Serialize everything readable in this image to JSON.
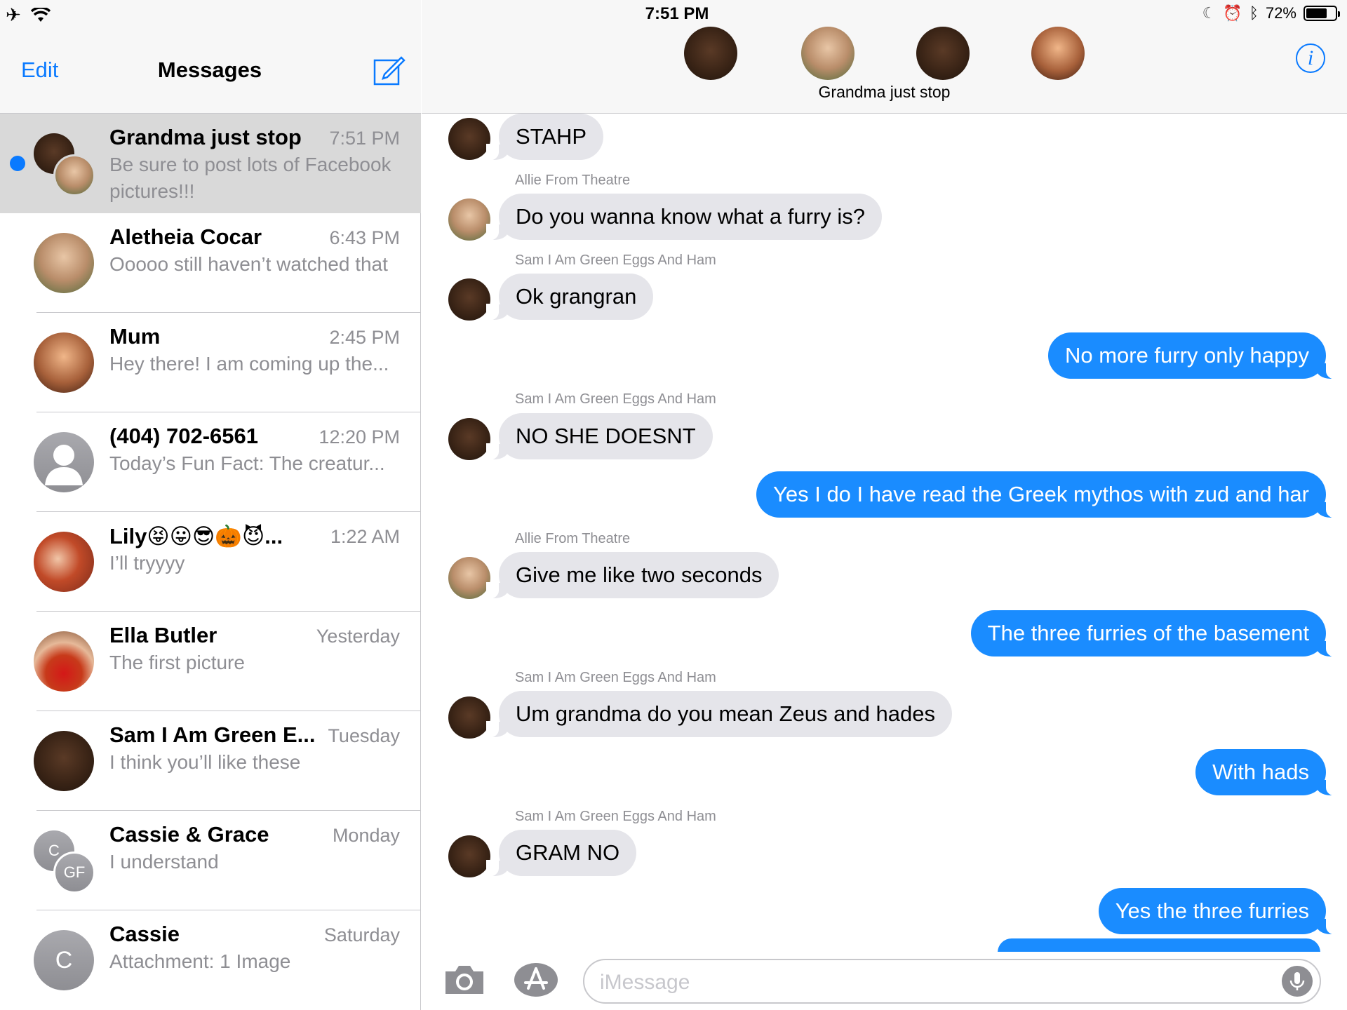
{
  "status_bar": {
    "time": "7:51 PM",
    "battery": "72%",
    "battery_level": 0.72,
    "icons": [
      "airplane-icon",
      "wifi-icon",
      "moon-icon",
      "alarm-icon",
      "bluetooth-icon",
      "battery-icon"
    ]
  },
  "sidebar": {
    "edit_label": "Edit",
    "title": "Messages",
    "compose_icon": "compose-icon",
    "conversations": [
      {
        "name": "Grandma just stop",
        "time": "7:51 PM",
        "preview": "Be sure to post lots of Facebook pictures!!!",
        "unread": true,
        "selected": true
      },
      {
        "name": "Aletheia Cocar",
        "time": "6:43 PM",
        "preview": "Ooooo still haven’t watched that"
      },
      {
        "name": "Mum",
        "time": "2:45 PM",
        "preview": "Hey there! I am coming up the..."
      },
      {
        "name": "(404) 702-6561",
        "time": "12:20 PM",
        "preview": "Today’s Fun Fact: The creatur..."
      },
      {
        "name": "Lily😝😛😎🎃😈...",
        "time": "1:22 AM",
        "preview": "I’ll tryyyy"
      },
      {
        "name": "Ella Butler",
        "time": "Yesterday",
        "preview": "The first picture"
      },
      {
        "name": "Sam I Am Green E...",
        "time": "Tuesday",
        "preview": "I think you’ll like these"
      },
      {
        "name": "Cassie & Grace",
        "time": "Monday",
        "preview": "I understand",
        "initials": [
          "C",
          "GF"
        ]
      },
      {
        "name": "Cassie",
        "time": "Saturday",
        "preview": "Attachment: 1 Image",
        "initials": [
          "C"
        ]
      }
    ]
  },
  "chat": {
    "group_name": "Grandma just stop",
    "info_icon": "info-icon",
    "messages": [
      {
        "dir": "in",
        "sender": "",
        "text": "STAHP"
      },
      {
        "dir": "in",
        "sender": "Allie From Theatre",
        "text": "Do you wanna know what a furry is?"
      },
      {
        "dir": "in",
        "sender": "Sam I Am Green Eggs And Ham",
        "text": "Ok grangran"
      },
      {
        "dir": "out",
        "sender": "",
        "text": "No more furry only happy"
      },
      {
        "dir": "in",
        "sender": "Sam I Am Green Eggs And Ham",
        "text": "NO SHE DOESNT"
      },
      {
        "dir": "out",
        "sender": "",
        "text": "Yes I do I have read the Greek mythos with zud and har"
      },
      {
        "dir": "in",
        "sender": "Allie From Theatre",
        "text": "Give me like two seconds"
      },
      {
        "dir": "out",
        "sender": "",
        "text": "The three furries of the basement"
      },
      {
        "dir": "in",
        "sender": "Sam I Am Green Eggs And Ham",
        "text": "Um grandma do you mean Zeus and hades"
      },
      {
        "dir": "out",
        "sender": "",
        "text": "With hads"
      },
      {
        "dir": "in",
        "sender": "Sam I Am Green Eggs And Ham",
        "text": "GRAM NO"
      },
      {
        "dir": "out",
        "sender": "",
        "text": "Yes the three furries"
      }
    ],
    "input_placeholder": "iMessage",
    "camera_icon": "camera-icon",
    "apps_icon": "app-store-icon",
    "mic_icon": "microphone-icon"
  }
}
